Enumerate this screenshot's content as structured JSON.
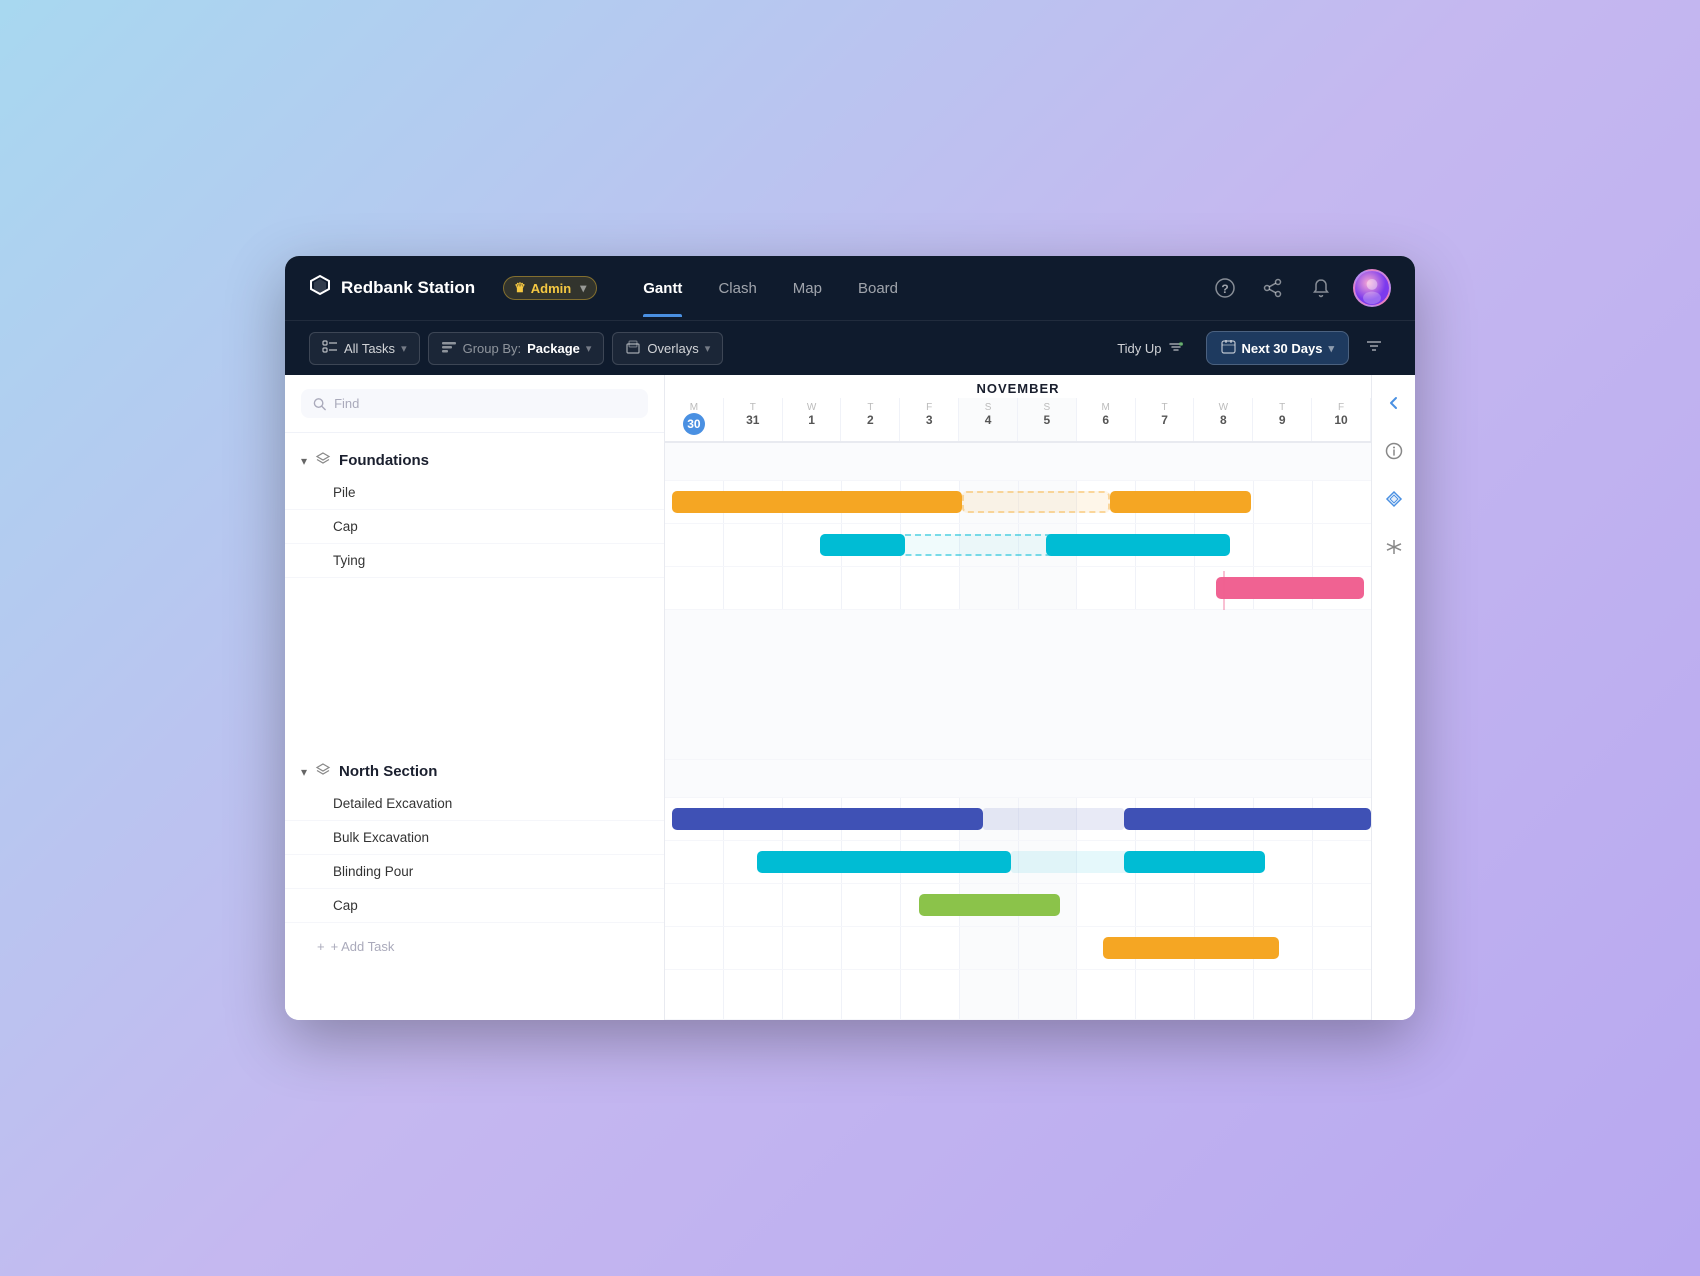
{
  "app": {
    "title": "Redbank Station",
    "logo_icon": "◆",
    "admin_label": "Admin",
    "crown_icon": "♛"
  },
  "nav": {
    "tabs": [
      {
        "label": "Gantt",
        "active": true
      },
      {
        "label": "Clash",
        "active": false
      },
      {
        "label": "Map",
        "active": false
      },
      {
        "label": "Board",
        "active": false
      }
    ]
  },
  "toolbar": {
    "all_tasks_label": "All Tasks",
    "group_by_label": "Group By:",
    "group_by_value": "Package",
    "overlays_label": "Overlays",
    "tidy_up_label": "Tidy Up",
    "next30_label": "Next 30 Days"
  },
  "search": {
    "placeholder": "Find"
  },
  "groups": [
    {
      "id": "foundations",
      "title": "Foundations",
      "tasks": [
        {
          "name": "Pile"
        },
        {
          "name": "Cap"
        },
        {
          "name": "Tying"
        }
      ]
    },
    {
      "id": "north-section",
      "title": "North Section",
      "tasks": [
        {
          "name": "Detailed Excavation"
        },
        {
          "name": "Bulk Excavation"
        },
        {
          "name": "Blinding Pour"
        },
        {
          "name": "Cap"
        }
      ]
    }
  ],
  "calendar": {
    "month": "NOVEMBER",
    "days": [
      {
        "letter": "M",
        "num": "30",
        "today": true,
        "weekend": false
      },
      {
        "letter": "T",
        "num": "31",
        "today": false,
        "weekend": false
      },
      {
        "letter": "W",
        "num": "1",
        "today": false,
        "weekend": false
      },
      {
        "letter": "T",
        "num": "2",
        "today": false,
        "weekend": false
      },
      {
        "letter": "F",
        "num": "3",
        "today": false,
        "weekend": false
      },
      {
        "letter": "S",
        "num": "4",
        "today": false,
        "weekend": true
      },
      {
        "letter": "S",
        "num": "5",
        "today": false,
        "weekend": true
      },
      {
        "letter": "M",
        "num": "6",
        "today": false,
        "weekend": false
      },
      {
        "letter": "T",
        "num": "7",
        "today": false,
        "weekend": false
      },
      {
        "letter": "W",
        "num": "8",
        "today": false,
        "weekend": false
      },
      {
        "letter": "T",
        "num": "9",
        "today": false,
        "weekend": false
      },
      {
        "letter": "F",
        "num": "10",
        "today": false,
        "weekend": false
      }
    ]
  },
  "add_task_label": "+ Add Task",
  "icons": {
    "search": "🔍",
    "chevron_down": "▾",
    "chevron_right": "▸",
    "layers": "⊞",
    "filter": "☰",
    "calendar": "📅",
    "back_arrow": "←",
    "info": "ⓘ",
    "diamond": "◇",
    "asterisk": "✳",
    "share": "↗",
    "bell": "🔔",
    "help": "?"
  }
}
